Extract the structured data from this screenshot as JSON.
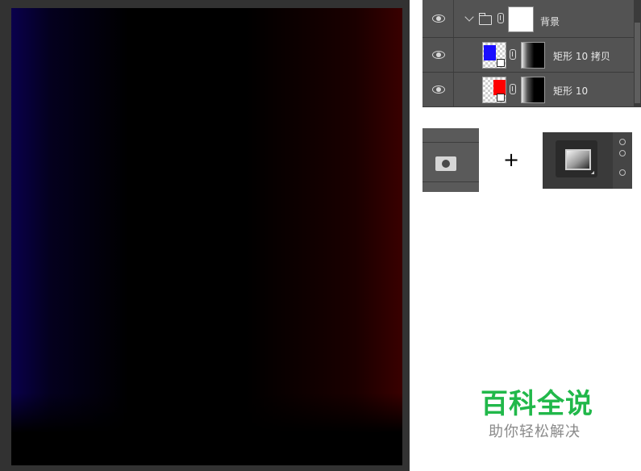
{
  "layers": [
    {
      "name": "背景",
      "type": "group"
    },
    {
      "name": "矩形 10 拷贝",
      "color": "#1a0dff"
    },
    {
      "name": "矩形 10",
      "color": "#ff0000"
    }
  ],
  "plus": "+",
  "watermark": {
    "title": "百科全说",
    "subtitle": "助你轻松解决"
  },
  "colors": {
    "watermark_green": "#21b84a",
    "layer_blue": "#1a0dff",
    "layer_red": "#ff0000"
  },
  "icons": [
    "eye-icon",
    "chevron-down-icon",
    "folder-icon",
    "link-icon",
    "shape-icon",
    "add-mask-icon",
    "gradient-tool-icon"
  ]
}
